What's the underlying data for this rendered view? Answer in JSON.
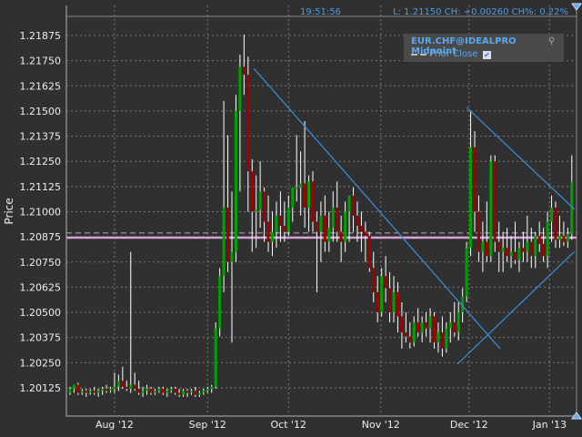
{
  "header": {
    "time": "19:51:56",
    "quote": "L: 1.21150 CH: +0.00260 CH%: 0.22%"
  },
  "legend": {
    "title": "EUR.CHF@IDEALPRO Midpoint",
    "prior_close_label": "Prior Close",
    "prior_close_checked": true,
    "icon": "magnifier-icon"
  },
  "colors": {
    "up": "#00a000",
    "down": "#a00000",
    "wick": "#ffffff",
    "trendline": "#3a8de0",
    "prior_close": "#b0b0b0",
    "last_line": "#d8a0d8",
    "accent": "#4a9be8"
  },
  "chart_data": {
    "type": "candlestick",
    "ylabel": "Price",
    "ylim": [
      1.2002,
      1.2199
    ],
    "yticks": [
      "1.20125",
      "1.20250",
      "1.20375",
      "1.20500",
      "1.20625",
      "1.20750",
      "1.20875",
      "1.21000",
      "1.21125",
      "1.21250",
      "1.21375",
      "1.21500",
      "1.21625",
      "1.21750",
      "1.21875"
    ],
    "xticks": [
      {
        "label": "Aug '12",
        "bar": 11
      },
      {
        "label": "Sep '12",
        "bar": 34
      },
      {
        "label": "Oct '12",
        "bar": 54
      },
      {
        "label": "Nov '12",
        "bar": 76.8
      },
      {
        "label": "Dec '12",
        "bar": 98.6
      },
      {
        "label": "Jan '13",
        "bar": 118.5
      }
    ],
    "grid": true,
    "prior_close": 1.20894,
    "last_line": 1.20871,
    "trendlines": [
      {
        "from": [
          45.4,
          1.21712
        ],
        "to": [
          106.3,
          1.20319
        ]
      },
      {
        "from": [
          98,
          1.21518
        ],
        "to": [
          124.7,
          1.21011
        ]
      },
      {
        "from": [
          95.7,
          1.20242
        ],
        "to": [
          124.7,
          1.20803
        ]
      }
    ],
    "ohlc": [
      [
        1.201,
        1.2013,
        1.2009,
        1.2012
      ],
      [
        1.2012,
        1.2014,
        1.201,
        1.2014
      ],
      [
        1.2014,
        1.2015,
        1.2009,
        1.201
      ],
      [
        1.201,
        1.2012,
        1.2009,
        1.2011
      ],
      [
        1.2011,
        1.2012,
        1.2008,
        1.201
      ],
      [
        1.201,
        1.2012,
        1.2009,
        1.2011
      ],
      [
        1.2011,
        1.2013,
        1.2009,
        1.201
      ],
      [
        1.201,
        1.2012,
        1.2008,
        1.2011
      ],
      [
        1.2011,
        1.2013,
        1.2009,
        1.2012
      ],
      [
        1.2012,
        1.2014,
        1.201,
        1.2011
      ],
      [
        1.2011,
        1.2013,
        1.201,
        1.2012
      ],
      [
        1.2012,
        1.202,
        1.201,
        1.2013
      ],
      [
        1.2013,
        1.2019,
        1.2011,
        1.2016
      ],
      [
        1.2016,
        1.2023,
        1.2012,
        1.2013
      ],
      [
        1.2013,
        1.2016,
        1.2011,
        1.2012
      ],
      [
        1.2012,
        1.208,
        1.201,
        1.2014
      ],
      [
        1.2014,
        1.202,
        1.2011,
        1.2012
      ],
      [
        1.2012,
        1.2016,
        1.2009,
        1.201
      ],
      [
        1.201,
        1.2013,
        1.2008,
        1.2011
      ],
      [
        1.2011,
        1.2014,
        1.2009,
        1.2012
      ],
      [
        1.2012,
        1.2013,
        1.2009,
        1.201
      ],
      [
        1.201,
        1.2012,
        1.2009,
        1.2011
      ],
      [
        1.2011,
        1.2013,
        1.201,
        1.2012
      ],
      [
        1.2012,
        1.2013,
        1.2009,
        1.201
      ],
      [
        1.201,
        1.2012,
        1.2008,
        1.2011
      ],
      [
        1.2011,
        1.2013,
        1.201,
        1.2012
      ],
      [
        1.2012,
        1.2013,
        1.2009,
        1.201
      ],
      [
        1.201,
        1.2012,
        1.2008,
        1.2009
      ],
      [
        1.2009,
        1.2012,
        1.2008,
        1.2011
      ],
      [
        1.2011,
        1.2012,
        1.2008,
        1.201
      ],
      [
        1.201,
        1.2012,
        1.2009,
        1.2011
      ],
      [
        1.2011,
        1.2013,
        1.2008,
        1.2009
      ],
      [
        1.2009,
        1.2011,
        1.2008,
        1.201
      ],
      [
        1.201,
        1.2012,
        1.2009,
        1.2011
      ],
      [
        1.2011,
        1.2013,
        1.201,
        1.2012
      ],
      [
        1.2012,
        1.2014,
        1.201,
        1.2013
      ],
      [
        1.2013,
        1.2045,
        1.2012,
        1.2042
      ],
      [
        1.2042,
        1.2072,
        1.2038,
        1.2068
      ],
      [
        1.2068,
        1.2155,
        1.206,
        1.2102
      ],
      [
        1.2102,
        1.2138,
        1.207,
        1.2075
      ],
      [
        1.2075,
        1.211,
        1.2035,
        1.208
      ],
      [
        1.208,
        1.2158,
        1.2075,
        1.215
      ],
      [
        1.215,
        1.2178,
        1.211,
        1.2172
      ],
      [
        1.2172,
        1.2188,
        1.2158,
        1.2168
      ],
      [
        1.2168,
        1.2177,
        1.21,
        1.212
      ],
      [
        1.212,
        1.2126,
        1.208,
        1.21
      ],
      [
        1.21,
        1.2118,
        1.2082,
        1.2101
      ],
      [
        1.2101,
        1.2125,
        1.2092,
        1.211
      ],
      [
        1.211,
        1.2112,
        1.2085,
        1.2095
      ],
      [
        1.2095,
        1.2108,
        1.208,
        1.2085
      ],
      [
        1.2085,
        1.21,
        1.2078,
        1.209
      ],
      [
        1.209,
        1.2105,
        1.2082,
        1.2098
      ],
      [
        1.2098,
        1.211,
        1.2085,
        1.2093
      ],
      [
        1.2093,
        1.2105,
        1.2085,
        1.209
      ],
      [
        1.209,
        1.2108,
        1.2088,
        1.2102
      ],
      [
        1.2102,
        1.2112,
        1.2095,
        1.2112
      ],
      [
        1.2112,
        1.2138,
        1.2105,
        1.2112
      ],
      [
        1.2112,
        1.213,
        1.2098,
        1.2114
      ],
      [
        1.2114,
        1.2145,
        1.2092,
        1.2102
      ],
      [
        1.2102,
        1.2118,
        1.209,
        1.2115
      ],
      [
        1.2115,
        1.212,
        1.209,
        1.2095
      ],
      [
        1.2095,
        1.21,
        1.206,
        1.209
      ],
      [
        1.209,
        1.2105,
        1.2075,
        1.2098
      ],
      [
        1.2098,
        1.2108,
        1.208,
        1.2085
      ],
      [
        1.2085,
        1.21,
        1.208,
        1.2092
      ],
      [
        1.2092,
        1.211,
        1.2085,
        1.2102
      ],
      [
        1.2102,
        1.2115,
        1.2085,
        1.209
      ],
      [
        1.209,
        1.2098,
        1.2075,
        1.2085
      ],
      [
        1.2085,
        1.2105,
        1.208,
        1.21
      ],
      [
        1.21,
        1.2108,
        1.2085,
        1.2108
      ],
      [
        1.2108,
        1.2112,
        1.209,
        1.2098
      ],
      [
        1.2098,
        1.2105,
        1.2085,
        1.2093
      ],
      [
        1.2093,
        1.21,
        1.208,
        1.209
      ],
      [
        1.209,
        1.2095,
        1.2075,
        1.2088
      ],
      [
        1.2088,
        1.209,
        1.207,
        1.2072
      ],
      [
        1.2072,
        1.208,
        1.2055,
        1.206
      ],
      [
        1.206,
        1.2068,
        1.2045,
        1.205
      ],
      [
        1.205,
        1.2072,
        1.2048,
        1.2068
      ],
      [
        1.2068,
        1.2078,
        1.2055,
        1.2062
      ],
      [
        1.2062,
        1.207,
        1.2045,
        1.205
      ],
      [
        1.205,
        1.2068,
        1.2045,
        1.206
      ],
      [
        1.206,
        1.2065,
        1.204,
        1.2048
      ],
      [
        1.2048,
        1.2055,
        1.2032,
        1.204
      ],
      [
        1.204,
        1.205,
        1.2035,
        1.2038
      ],
      [
        1.2038,
        1.2045,
        1.2032,
        1.2035
      ],
      [
        1.2035,
        1.2048,
        1.2033,
        1.2045
      ],
      [
        1.2045,
        1.2052,
        1.2038,
        1.204
      ],
      [
        1.204,
        1.2048,
        1.2035,
        1.2045
      ],
      [
        1.2045,
        1.205,
        1.2038,
        1.2042
      ],
      [
        1.2042,
        1.2052,
        1.2035,
        1.2048
      ],
      [
        1.2048,
        1.205,
        1.2032,
        1.2035
      ],
      [
        1.2035,
        1.2045,
        1.203,
        1.204
      ],
      [
        1.204,
        1.2048,
        1.2028,
        1.2032
      ],
      [
        1.2032,
        1.2045,
        1.203,
        1.2042
      ],
      [
        1.2042,
        1.205,
        1.2035,
        1.2045
      ],
      [
        1.2045,
        1.2055,
        1.2038,
        1.204
      ],
      [
        1.204,
        1.2055,
        1.2036,
        1.205
      ],
      [
        1.205,
        1.2062,
        1.2045,
        1.2058
      ],
      [
        1.2058,
        1.2085,
        1.2055,
        1.2082
      ],
      [
        1.2082,
        1.215,
        1.2078,
        1.2132
      ],
      [
        1.2132,
        1.214,
        1.209,
        1.21
      ],
      [
        1.21,
        1.2108,
        1.2075,
        1.208
      ],
      [
        1.208,
        1.2095,
        1.207,
        1.2085
      ],
      [
        1.2085,
        1.2105,
        1.2075,
        1.2078
      ],
      [
        1.2078,
        1.2128,
        1.2075,
        1.2125
      ],
      [
        1.2125,
        1.2128,
        1.208,
        1.2085
      ],
      [
        1.2085,
        1.2095,
        1.207,
        1.208
      ],
      [
        1.208,
        1.209,
        1.207,
        1.2082
      ],
      [
        1.2082,
        1.2092,
        1.2075,
        1.2078
      ],
      [
        1.2078,
        1.2088,
        1.2072,
        1.208
      ],
      [
        1.208,
        1.2095,
        1.2074,
        1.2076
      ],
      [
        1.2076,
        1.2085,
        1.207,
        1.2082
      ],
      [
        1.2082,
        1.209,
        1.2075,
        1.208
      ],
      [
        1.208,
        1.2098,
        1.2075,
        1.2085
      ],
      [
        1.2085,
        1.2092,
        1.2072,
        1.2078
      ],
      [
        1.2078,
        1.209,
        1.2072,
        1.2088
      ],
      [
        1.2088,
        1.2095,
        1.208,
        1.2084
      ],
      [
        1.2084,
        1.2092,
        1.2075,
        1.2078
      ],
      [
        1.2078,
        1.21,
        1.2072,
        1.2095
      ],
      [
        1.2095,
        1.2108,
        1.2085,
        1.2102
      ],
      [
        1.2102,
        1.2105,
        1.2082,
        1.2086
      ],
      [
        1.2086,
        1.2098,
        1.2082,
        1.2088
      ],
      [
        1.2088,
        1.2095,
        1.2083,
        1.2085
      ],
      [
        1.2085,
        1.2092,
        1.2082,
        1.2089
      ],
      [
        1.2089,
        1.2128,
        1.2086,
        1.2115
      ]
    ]
  }
}
